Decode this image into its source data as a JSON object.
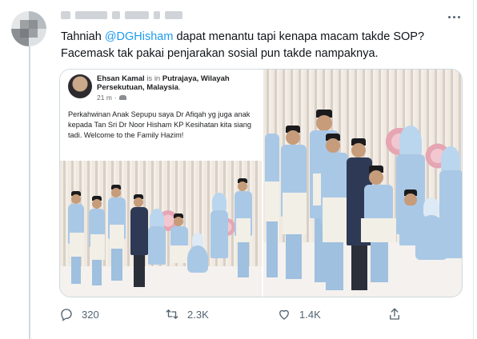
{
  "tweet": {
    "text_prefix": "Tahniah ",
    "mention": "@DGHisham",
    "text_suffix": " dapat menantu tapi kenapa macam takde SOP? Facemask tak pakai penjarakan sosial pun takde nampaknya.",
    "more_icon": "more-horizontal-icon"
  },
  "embedded_post": {
    "author": "Ehsan Kamal",
    "is_in": "is in",
    "location": "Putrajaya, Wilayah Persekutuan, Malaysia",
    "location_suffix": ".",
    "time": "21 m",
    "separator": "·",
    "body": "Perkahwinan Anak Sepupu saya Dr Afiqah yg juga anak kepada Tan Sri Dr Noor Hisham KP Kesihatan kita siang tadi.  Welcome to the Family Hazim!"
  },
  "actions": {
    "reply_count": "320",
    "retweet_count": "2.3K",
    "like_count": "1.4K"
  },
  "colors": {
    "accent": "#1d9bf0",
    "text": "#0f1419",
    "muted": "#536471",
    "border": "#cfd9de"
  }
}
